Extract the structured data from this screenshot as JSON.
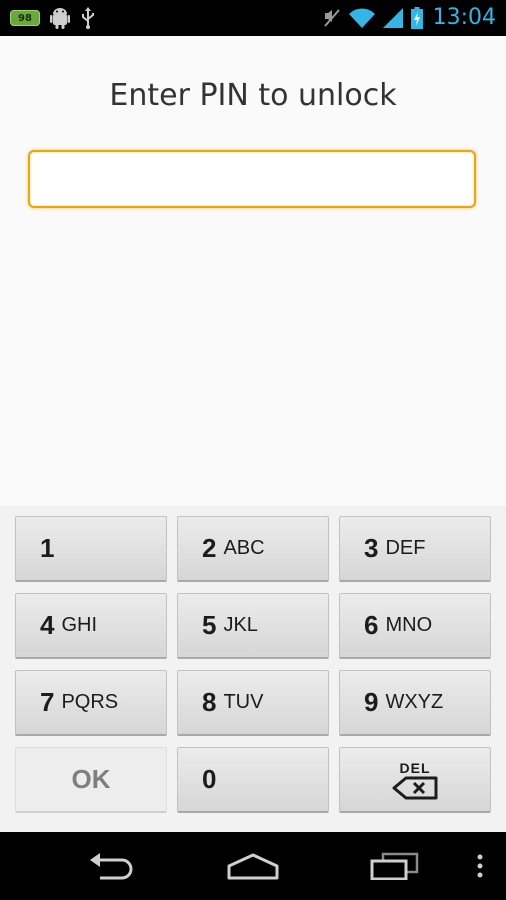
{
  "status_bar": {
    "notification_badge": "98",
    "clock": "13:04",
    "icons": [
      "battery-notification-icon",
      "android-debug-icon",
      "usb-icon",
      "vibrate-off-icon",
      "wifi-icon",
      "signal-icon",
      "battery-charging-icon"
    ],
    "clock_color": "#33b5e5"
  },
  "unlock": {
    "prompt": "Enter PIN to unlock",
    "pin_value": "",
    "accent_color": "#f0a30a"
  },
  "keypad": {
    "keys": [
      {
        "digit": "1",
        "letters": ""
      },
      {
        "digit": "2",
        "letters": "ABC"
      },
      {
        "digit": "3",
        "letters": "DEF"
      },
      {
        "digit": "4",
        "letters": "GHI"
      },
      {
        "digit": "5",
        "letters": "JKL"
      },
      {
        "digit": "6",
        "letters": "MNO"
      },
      {
        "digit": "7",
        "letters": "PQRS"
      },
      {
        "digit": "8",
        "letters": "TUV"
      },
      {
        "digit": "9",
        "letters": "WXYZ"
      }
    ],
    "ok_label": "OK",
    "zero_label": "0",
    "del_label": "DEL"
  },
  "nav_bar": {
    "icons": [
      "back-icon",
      "home-icon",
      "recent-apps-icon",
      "overflow-menu-icon"
    ]
  }
}
